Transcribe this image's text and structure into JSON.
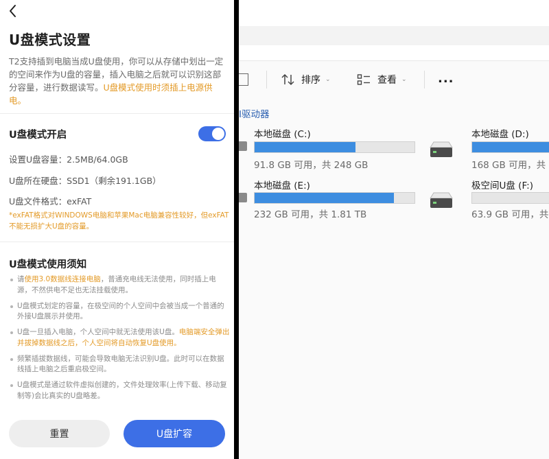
{
  "settings": {
    "title": "U盘模式设置",
    "intro_text": "T2支持插到电脑当成U盘使用，你可以从存储中划出一定的空间来作为U盘的容量，插入电脑之后就可以识别这部分容量，进行数据读写。",
    "intro_warning": "U盘模式使用时须插上电源供电。",
    "mode_title": "U盘模式开启",
    "toggle_on": true,
    "capacity": "设置U盘容量：2.5MB/64.0GB",
    "disk": "U盘所在硬盘：SSD1（剩余191.1GB）",
    "format": "U盘文件格式：exFAT",
    "format_warning": "*exFAT格式对WINDOWS电脑和苹果Mac电脑兼容性较好，但exFAT不能无损扩大U盘的容量。",
    "notes_title": "U盘模式使用须知",
    "notes": [
      {
        "pre": "请",
        "hl": "使用3.0数据线连接电脑",
        "post": "，普通充电线无法使用，同时插上电源，不然供电不足也无法挂载使用。"
      },
      {
        "pre": "U盘模式划定的容量，在极空间的个人空间中会被当成一个普通的外接U盘展示并使用。",
        "hl": "",
        "post": ""
      },
      {
        "pre": "U盘一旦插入电脑，个人空间中就无法使用该U盘。",
        "hl": "电脑端安全弹出并拔掉数据线之后，个人空间将自动恢复U盘使用。",
        "post": ""
      },
      {
        "pre": "频繁插拔数据线，可能会导致电脑无法识别U盘。此时可以在数据线插上电脑之后重启极空间。",
        "hl": "",
        "post": ""
      },
      {
        "pre": "U盘模式是通过软件虚拟创建的，文件处理效率(上传下载、移动复制等)会比真实的U盘略差。",
        "hl": "",
        "post": ""
      }
    ],
    "reset_label": "重置",
    "expand_label": "U盘扩容"
  },
  "explorer": {
    "toolbar": {
      "sort_label": "排序",
      "view_label": "查看",
      "more_label": "..."
    },
    "section_label": "I驱动器",
    "drives": [
      {
        "name": "本地磁盘 (C:)",
        "size": "91.8 GB 可用，共 248 GB",
        "used_fraction": 0.63
      },
      {
        "name": "本地磁盘 (D:)",
        "size": "168 GB 可用，共",
        "used_fraction": 1.0
      },
      {
        "name": "本地磁盘 (E:)",
        "size": "232 GB 可用，共 1.81 TB",
        "used_fraction": 0.87
      },
      {
        "name": "极空间U盘 (F:)",
        "size": "63.9 GB 可用，共",
        "used_fraction": 0.0
      }
    ]
  },
  "colors": {
    "accent": "#3d6fe6",
    "warning": "#e39a27",
    "drive_bar": "#3d8de0"
  }
}
